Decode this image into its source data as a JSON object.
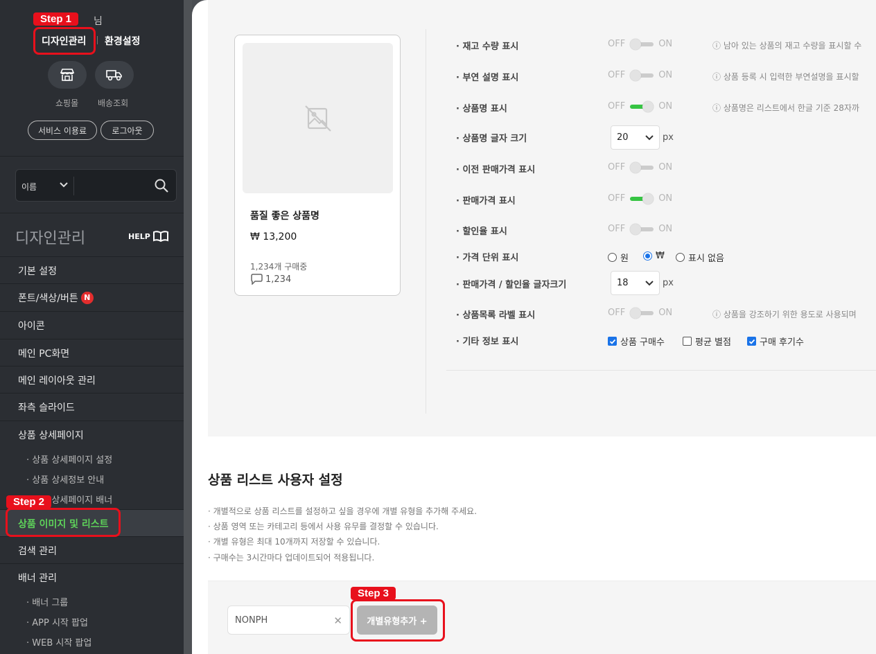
{
  "sidebar": {
    "user_suffix": "님",
    "design_link": "디자인관리",
    "env_link": "환경설정",
    "shop_label": "쇼핑몰",
    "delivery_label": "배송조회",
    "service_pill": "서비스 이용료",
    "logout_pill": "로그아웃",
    "search_select": "이름",
    "section_title": "디자인관리",
    "help_label": "HELP",
    "menu": {
      "basic": "기본 설정",
      "font": "폰트/색상/버튼",
      "font_badge": "N",
      "icon": "아이콘",
      "main_pc": "메인 PC화면",
      "main_layout": "메인 레이아웃 관리",
      "left_slide": "좌측 슬라이드",
      "product_detail": "상품 상세페이지",
      "sub_detail_setting": "· 상품 상세페이지 설정",
      "sub_detail_info": "· 상품 상세정보 안내",
      "sub_detail_banner": "· 상품 상세페이지 배너",
      "product_image_list": "상품 이미지 및 리스트",
      "search_manage": "검색 관리",
      "banner_manage": "배너 관리",
      "sub_banner_group": "· 배너 그룹",
      "sub_app_popup": "· APP 시작 팝업",
      "sub_web_popup": "· WEB 시작 팝업"
    }
  },
  "steps": {
    "step1": "Step 1",
    "step2": "Step 2",
    "step3": "Step 3"
  },
  "preview_card": {
    "name": "품질 좋은 상품명",
    "price": "₩ 13,200",
    "sold": "1,234개 구매중",
    "reviews": "1,234"
  },
  "toggle_text": {
    "off": "OFF",
    "on": "ON"
  },
  "settings": {
    "stock": {
      "label": "· 재고 수량 표시",
      "state": "off",
      "hint": "ⓘ 남아 있는 상품의 재고 수량을 표시할 수"
    },
    "extra_desc": {
      "label": "· 부연 설명 표시",
      "state": "off",
      "hint": "ⓘ 상품 등록 시 입력한 부연설명을 표시할"
    },
    "name_show": {
      "label": "· 상품명 표시",
      "state": "on",
      "hint": "ⓘ 상품명은 리스트에서 한글 기준 28자까"
    },
    "name_size": {
      "label": "· 상품명 글자 크기",
      "value": "20",
      "unit": "px"
    },
    "prev_price": {
      "label": "· 이전 판매가격 표시",
      "state": "off"
    },
    "sale_price": {
      "label": "· 판매가격 표시",
      "state": "on"
    },
    "discount": {
      "label": "· 할인율 표시",
      "state": "off"
    },
    "price_unit": {
      "label": "· 가격 단위 표시",
      "options": [
        "원",
        "₩",
        "표시 없음"
      ],
      "selected": "₩"
    },
    "price_font": {
      "label": "· 판매가격 / 할인율 글자크기",
      "value": "18",
      "unit": "px"
    },
    "list_label": {
      "label": "· 상품목록 라벨 표시",
      "state": "off",
      "hint": "ⓘ 상품을 강조하기 위한 용도로 사용되며"
    },
    "etc_info": {
      "label": "· 기타 정보 표시",
      "options": [
        "상품 구매수",
        "평균 별점",
        "구매 후기수"
      ],
      "checked": [
        "상품 구매수",
        "구매 후기수"
      ]
    }
  },
  "user_settings": {
    "title": "상품 리스트 사용자 설정",
    "desc1": "· 개별적으로 상품 리스트를 설정하고 싶을 경우에 개별 유형을 추가해 주세요.",
    "desc2": "· 상품 영역 또는 카테고리 등에서 사용 유무를 결정할 수 있습니다.",
    "desc3": "· 개별 유형은 최대 10개까지 저장할 수 있습니다.",
    "desc4": "· 구매수는 3시간마다 업데이트되어 적용됩니다.",
    "chip": "NONPH",
    "add_button": "개별유형추가 +"
  },
  "colors": {
    "accent_green": "#36c443",
    "step_red": "#e8101c",
    "active_menu_text": "#5ed35a",
    "sidebar_bg": "#2b2e33"
  }
}
